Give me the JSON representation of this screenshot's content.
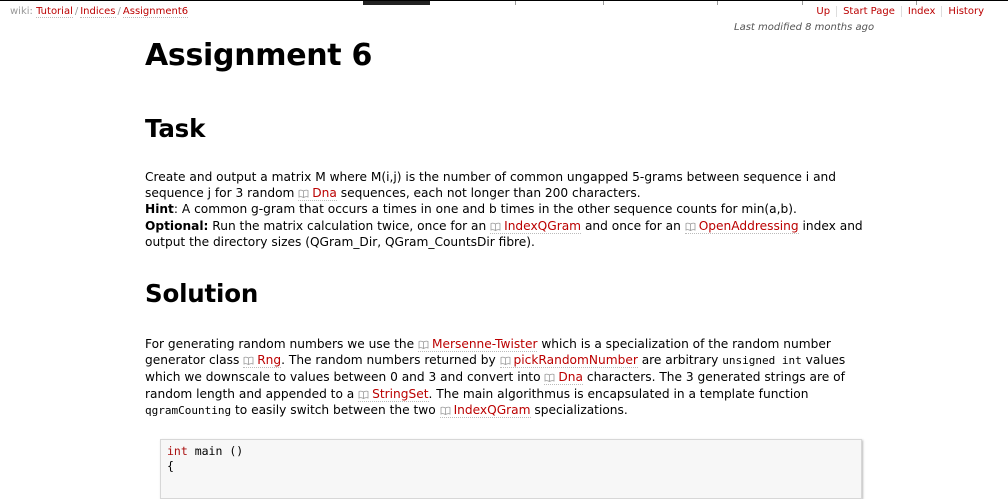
{
  "breadcrumb": {
    "prefix": "wiki:",
    "items": [
      "Tutorial",
      "Indices",
      "Assignment6"
    ]
  },
  "metanav": [
    "Up",
    "Start Page",
    "Index",
    "History"
  ],
  "last_modified": "Last modified 8 months ago",
  "page_title": "Assignment 6",
  "task": {
    "heading": "Task",
    "line1": "Create and output a matrix M where M(i,j) is the number of common ungapped 5-grams between sequence i",
    "line2_a": "and sequence j for 3 random",
    "line2_link": "Dna",
    "line2_b": "sequences, each not longer than 200 characters.",
    "hint_label": "Hint",
    "hint_text": ": A common g-gram that occurs a times in one and b times in the other sequence counts for min(a,b).",
    "optional_label": "Optional:",
    "optional_a": "Run the matrix calculation twice, once for an",
    "optional_link1": "IndexQGram",
    "optional_b": "and once for an",
    "optional_link2": "OpenAddressing",
    "optional_c": "index and output the directory sizes (QGram_Dir, QGram_CountsDir fibre)."
  },
  "solution": {
    "heading": "Solution",
    "t1": "For generating random numbers we use the",
    "l1": "Mersenne-Twister",
    "t2": "which is a specialization of the random number generator class",
    "l2": "Rng",
    "t3": ". The random numbers returned by",
    "l3": "pickRandomNumber",
    "t4": "are arbitrary",
    "c1": "unsigned int",
    "t5": "values which we downscale to values between 0 and 3 and convert into",
    "l4": "Dna",
    "t6": "characters. The 3 generated strings are of random length and appended to a",
    "l5": "StringSet",
    "t7": ". The main algorithmus is encapsulated in a template function",
    "c2": "qgramCounting",
    "t8": "to easily switch between the two",
    "l6": "IndexQGram",
    "t9": "specializations."
  },
  "code": {
    "kw": "int",
    "rest": " main ()",
    "line2": "{"
  }
}
